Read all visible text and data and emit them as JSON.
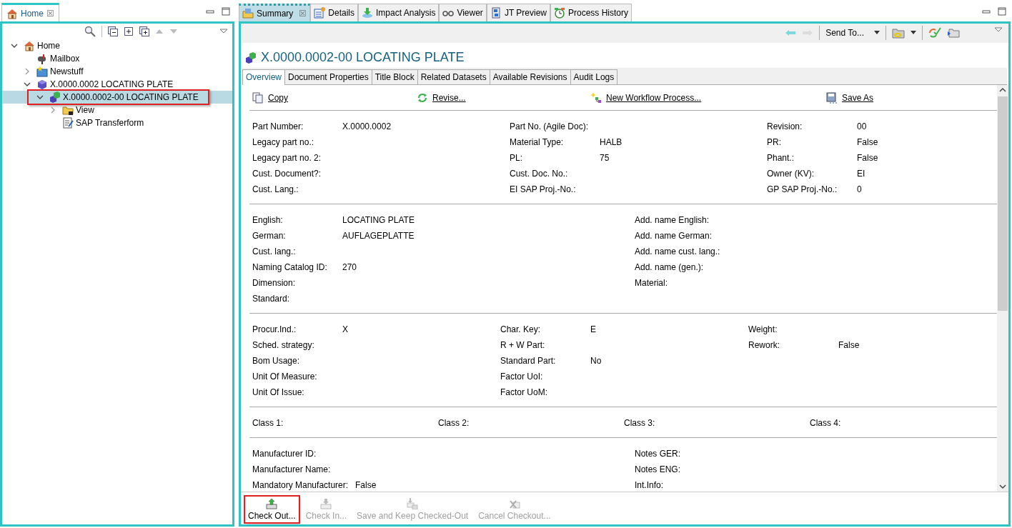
{
  "left_view": {
    "tab": {
      "label": "Home",
      "selected": true,
      "close": "☒"
    },
    "tree": [
      {
        "label": "Home",
        "expanded": true,
        "selected": false,
        "highlighted": false,
        "children": [
          {
            "label": "Mailbox",
            "selected": false,
            "highlighted": false
          },
          {
            "label": "Newstuff",
            "expanded": false,
            "selected": false,
            "highlighted": false
          },
          {
            "label": "X.0000.0002 LOCATING PLATE",
            "expanded": true,
            "selected": false,
            "highlighted": false,
            "children": [
              {
                "label": "X.0000.0002-00 LOCATING PLATE",
                "expanded": true,
                "selected": true,
                "highlighted": true,
                "children": [
                  {
                    "label": "View",
                    "expanded": false,
                    "selected": false,
                    "highlighted": false
                  },
                  {
                    "label": "SAP Transferform",
                    "selected": false,
                    "highlighted": false
                  }
                ]
              }
            ]
          }
        ]
      }
    ]
  },
  "editor": {
    "tabs": [
      {
        "label": "Summary",
        "selected": true,
        "close": "☒"
      },
      {
        "label": "Details",
        "selected": false
      },
      {
        "label": "Impact Analysis",
        "selected": false
      },
      {
        "label": "Viewer",
        "selected": false
      },
      {
        "label": "JT Preview",
        "selected": false
      },
      {
        "label": "Process History",
        "selected": false
      }
    ],
    "toolbar": {
      "send_to": "Send To..."
    },
    "title": "X.0000.0002-00 LOCATING PLATE",
    "subtabs": [
      {
        "label": "Overview",
        "selected": true
      },
      {
        "label": "Document Properties",
        "selected": false
      },
      {
        "label": "Title Block",
        "selected": false
      },
      {
        "label": "Related Datasets",
        "selected": false
      },
      {
        "label": "Available Revisions",
        "selected": false
      },
      {
        "label": "Audit Logs",
        "selected": false
      }
    ],
    "actions": [
      {
        "label": "Copy"
      },
      {
        "label": "Revise..."
      },
      {
        "label": "New Workflow Process..."
      },
      {
        "label": "Save As"
      }
    ],
    "sections": [
      {
        "rows": [
          [
            {
              "label": "Part Number:",
              "value": "X.0000.0002"
            },
            {
              "label": "Part No. (Agile Doc):"
            },
            {
              "label": "Revision:",
              "value": "00"
            }
          ],
          [
            {
              "label": "Legacy part no.:"
            },
            {
              "label": "Material Type:",
              "value": "HALB"
            },
            {
              "label": "PR:",
              "value": "False"
            }
          ],
          [
            {
              "label": "Legacy part no. 2:"
            },
            {
              "label": "PL:",
              "value": "75"
            },
            {
              "label": "Phant.:",
              "value": "False"
            }
          ],
          [
            {
              "label": "Cust. Document?:"
            },
            {
              "label": "Cust. Doc. No.:"
            },
            {
              "label": "Owner (KV):",
              "value": "EI"
            }
          ],
          [
            {
              "label": "Cust. Lang.:"
            },
            {
              "label": "EI SAP Proj.-No.:"
            },
            {
              "label": "GP SAP Proj.-No.:",
              "value": "0"
            }
          ]
        ]
      },
      {
        "rows": [
          [
            {
              "label": "English:",
              "value": "LOCATING PLATE"
            },
            {
              "label": "Add. name English:"
            }
          ],
          [
            {
              "label": "German:",
              "value": "AUFLAGEPLATTE"
            },
            {
              "label": "Add. name German:"
            }
          ],
          [
            {
              "label": "Cust. lang.:"
            },
            {
              "label": "Add. name cust. lang.:"
            }
          ],
          [
            {
              "label": "Naming Catalog ID:",
              "value": "270"
            },
            {
              "label": "Add. name (gen.):"
            }
          ],
          [
            {
              "label": "Dimension:"
            },
            {
              "label": "Material:"
            }
          ],
          [
            {
              "label": "Standard:"
            }
          ]
        ]
      },
      {
        "rows": [
          [
            {
              "label": "Procur.Ind.:",
              "value": "X"
            },
            {
              "label": "Char. Key:",
              "value": "E"
            },
            {
              "label": "Weight:"
            }
          ],
          [
            {
              "label": "Sched. strategy:"
            },
            {
              "label": "R + W Part:"
            },
            {
              "label": "Rework:",
              "value": "False"
            }
          ],
          [
            {
              "label": "Bom Usage:"
            },
            {
              "label": "Standard Part:",
              "value": "No"
            }
          ],
          [
            {
              "label": "Unit Of Measure:"
            },
            {
              "label": "Factor UoI:"
            }
          ],
          [
            {
              "label": "Unit Of Issue:"
            },
            {
              "label": "Factor UoM:"
            }
          ]
        ]
      },
      {
        "rows": [
          [
            {
              "label": "Class 1:"
            },
            {
              "label": "Class 2:"
            },
            {
              "label": "Class 3:"
            },
            {
              "label": "Class 4:"
            }
          ]
        ]
      },
      {
        "rows": [
          [
            {
              "label": "Manufacturer ID:"
            },
            {
              "label": "Notes GER:"
            }
          ],
          [
            {
              "label": "Manufacturer Name:"
            },
            {
              "label": "Notes ENG:"
            }
          ],
          [
            {
              "label": "Mandatory Manufacturer:",
              "value": "False"
            },
            {
              "label": "Int.Info:"
            }
          ]
        ]
      }
    ],
    "bottom_buttons": [
      {
        "label": "Check Out...",
        "disabled": false,
        "highlighted": true
      },
      {
        "label": "Check In...",
        "disabled": true,
        "highlighted": false
      },
      {
        "label": "Save and Keep Checked-Out",
        "disabled": true,
        "highlighted": false
      },
      {
        "label": "Cancel Checkout...",
        "disabled": true,
        "highlighted": false
      }
    ]
  }
}
